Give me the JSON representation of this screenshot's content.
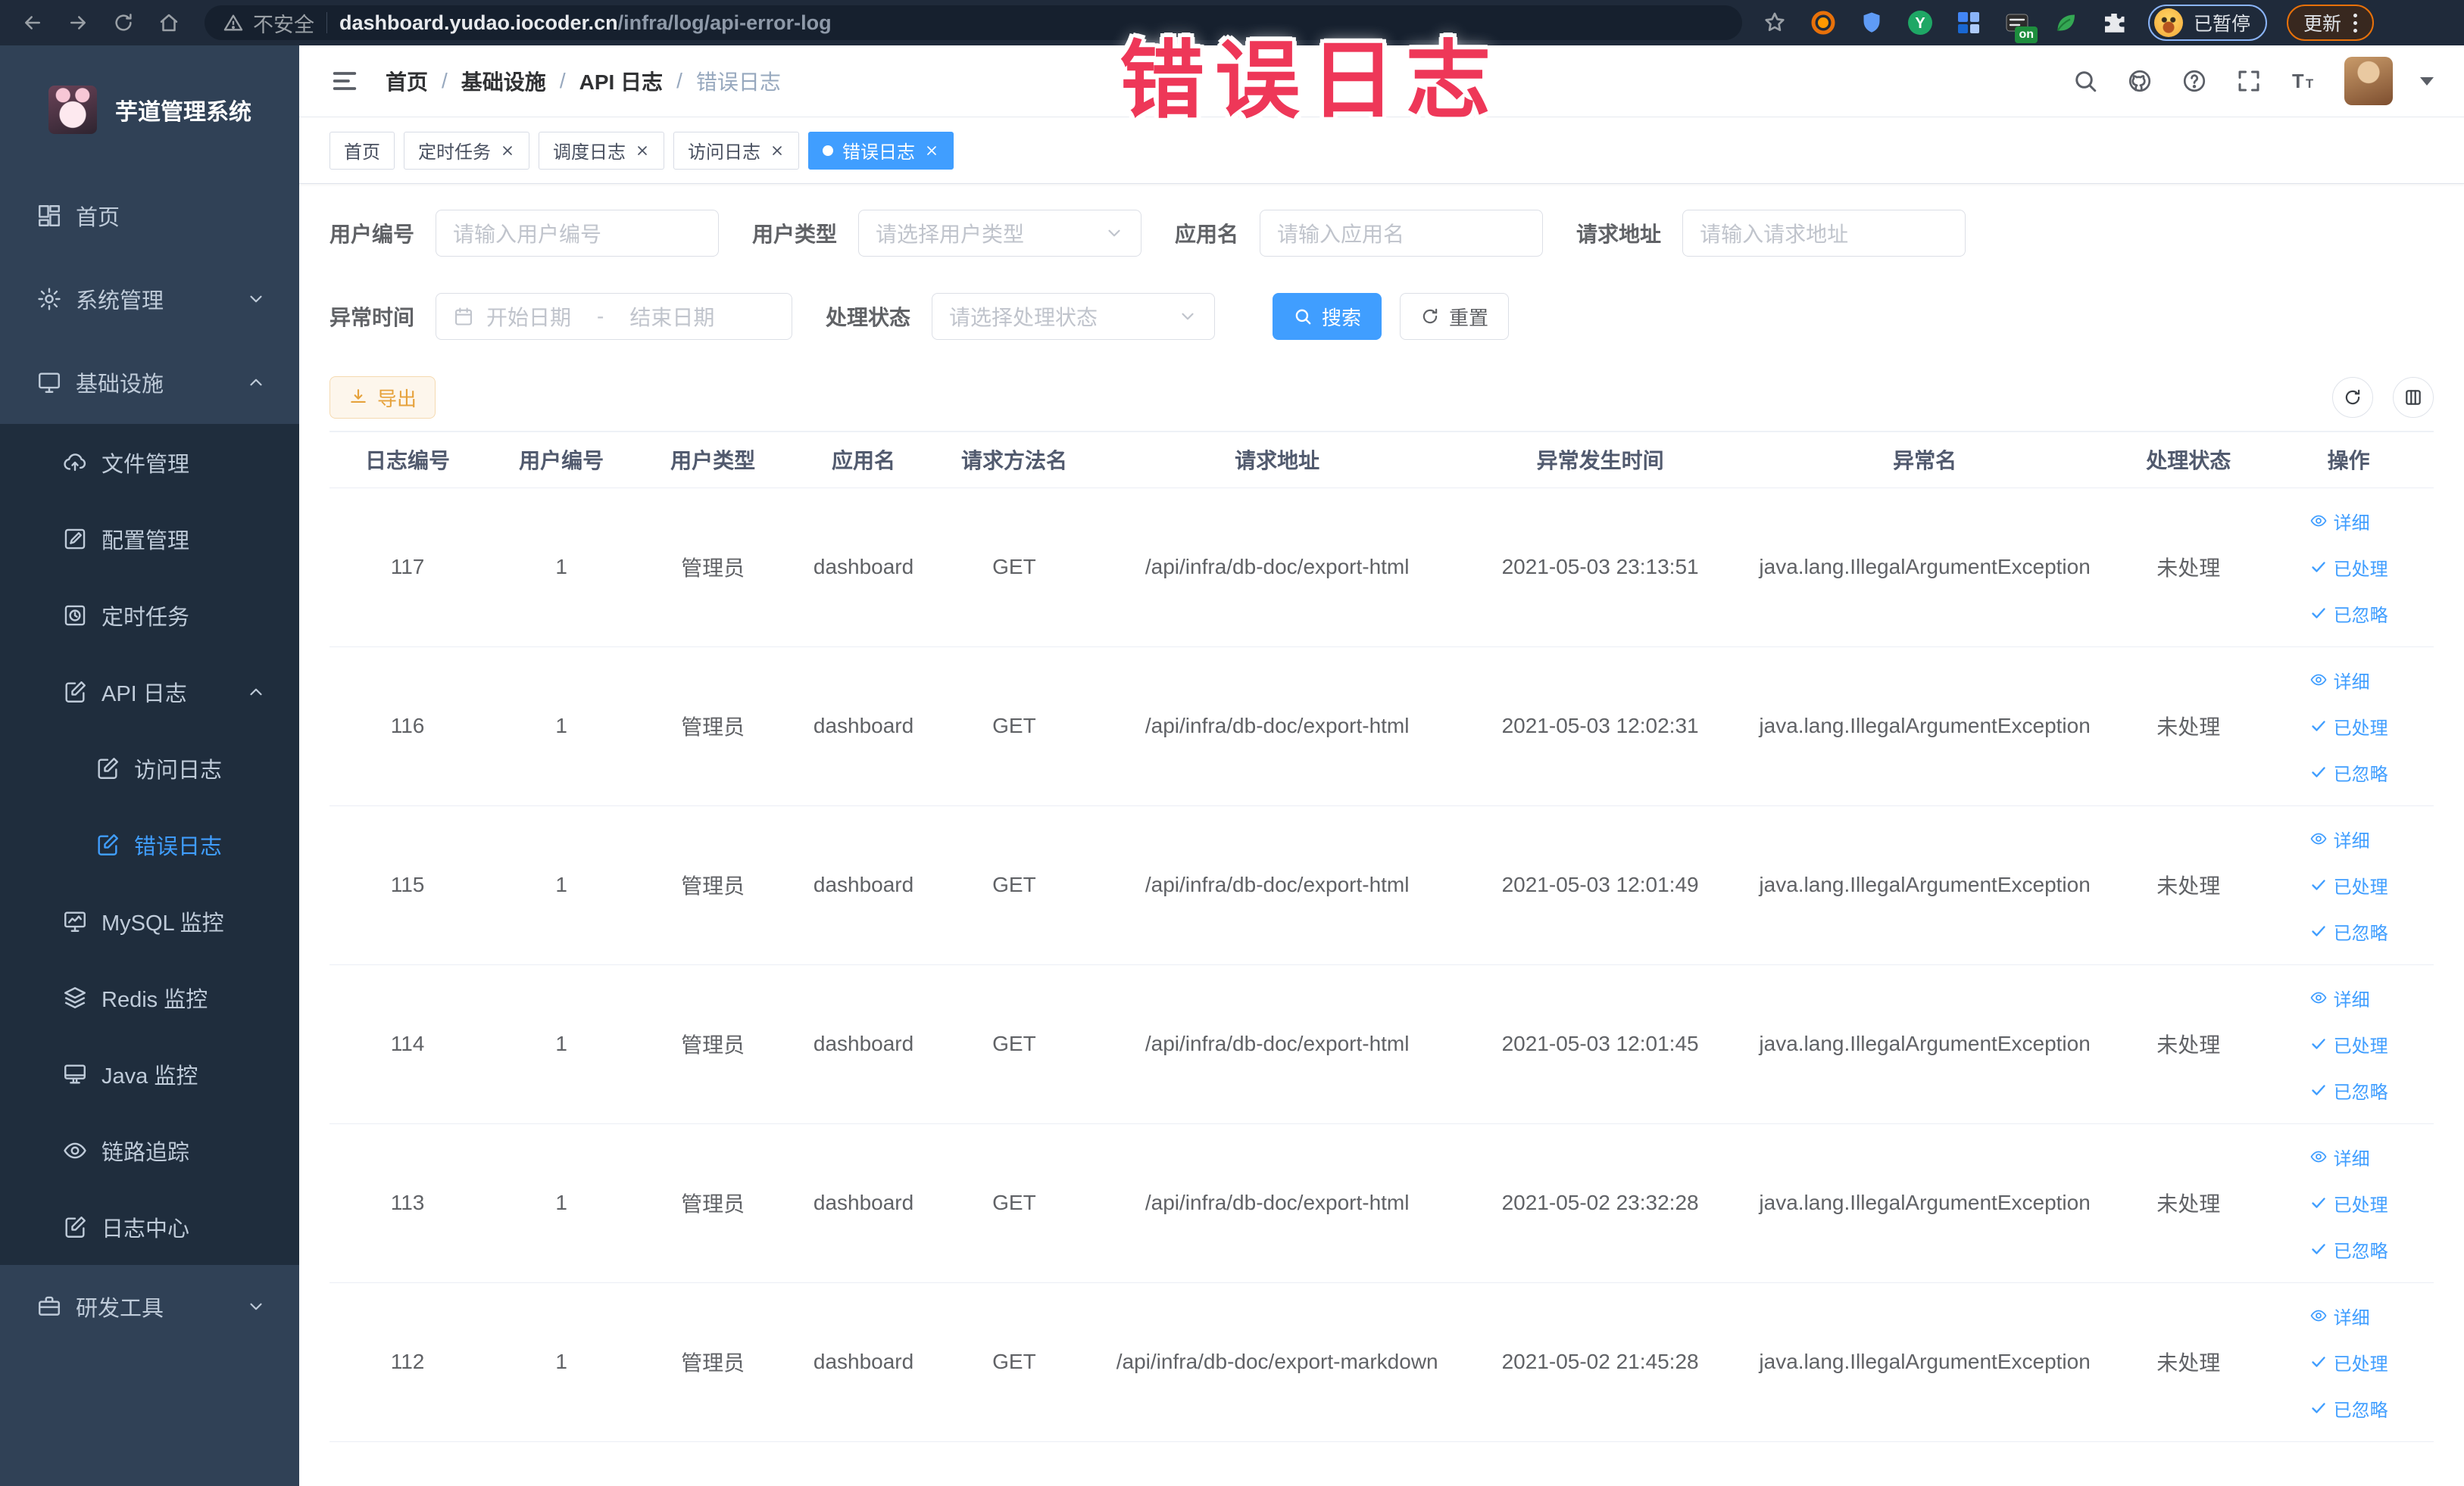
{
  "colors": {
    "primary": "#409eff",
    "annotation": "#ee3758",
    "export_text": "#e6a23c",
    "export_bg": "#fdf6ec",
    "export_border": "#f5dab1",
    "sidebar_bg": "#304156",
    "submenu_bg": "#1f2d3d",
    "sidebar_text": "#bfcbd9",
    "chrome_bg": "#1f2a3a"
  },
  "browser": {
    "security_label": "不安全",
    "url_domain": "dashboard.yudao.iocoder.cn",
    "url_path": "/infra/log/api-error-log",
    "extension_badge": "on",
    "profile_pill_label": "已暂停",
    "update_button_label": "更新"
  },
  "annotation": {
    "text": "错误日志"
  },
  "sidebar": {
    "title": "芋道管理系统",
    "items": [
      {
        "label": "首页"
      },
      {
        "label": "系统管理"
      },
      {
        "label": "基础设施"
      },
      {
        "label": "文件管理"
      },
      {
        "label": "配置管理"
      },
      {
        "label": "定时任务"
      },
      {
        "label": "API 日志"
      },
      {
        "label": "访问日志"
      },
      {
        "label": "错误日志"
      },
      {
        "label": "MySQL 监控"
      },
      {
        "label": "Redis 监控"
      },
      {
        "label": "Java 监控"
      },
      {
        "label": "链路追踪"
      },
      {
        "label": "日志中心"
      },
      {
        "label": "研发工具"
      }
    ]
  },
  "navbar": {
    "breadcrumb": [
      "首页",
      "基础设施",
      "API 日志",
      "错误日志"
    ],
    "separator": "/"
  },
  "tags": [
    {
      "label": "首页",
      "closable": false,
      "active": false
    },
    {
      "label": "定时任务",
      "closable": true,
      "active": false
    },
    {
      "label": "调度日志",
      "closable": true,
      "active": false
    },
    {
      "label": "访问日志",
      "closable": true,
      "active": false
    },
    {
      "label": "错误日志",
      "closable": true,
      "active": true
    }
  ],
  "filters": {
    "user_id": {
      "label": "用户编号",
      "placeholder": "请输入用户编号"
    },
    "user_type": {
      "label": "用户类型",
      "placeholder": "请选择用户类型"
    },
    "app_name": {
      "label": "应用名",
      "placeholder": "请输入应用名"
    },
    "request_url": {
      "label": "请求地址",
      "placeholder": "请输入请求地址"
    },
    "exception_time": {
      "label": "异常时间",
      "start_placeholder": "开始日期",
      "separator": "-",
      "end_placeholder": "结束日期"
    },
    "process_status": {
      "label": "处理状态",
      "placeholder": "请选择处理状态"
    },
    "search_label": "搜索",
    "reset_label": "重置"
  },
  "toolbar": {
    "export_label": "导出"
  },
  "table": {
    "columns": [
      {
        "key": "id",
        "label": "日志编号",
        "width": "7.42%"
      },
      {
        "key": "user_id",
        "label": "用户编号",
        "width": "7.2%"
      },
      {
        "key": "user_type",
        "label": "用户类型",
        "width": "7.2%"
      },
      {
        "key": "app",
        "label": "应用名",
        "width": "7.12%"
      },
      {
        "key": "method",
        "label": "请求方法名",
        "width": "7.2%"
      },
      {
        "key": "url",
        "label": "请求地址",
        "width": "17.8%"
      },
      {
        "key": "time",
        "label": "异常发生时间",
        "width": "12.9%"
      },
      {
        "key": "exception",
        "label": "异常名",
        "width": "17.95%"
      },
      {
        "key": "status",
        "label": "处理状态",
        "width": "7.12%"
      },
      {
        "key": "actions",
        "label": "操作",
        "width": "8.09%"
      }
    ],
    "rows": [
      {
        "id": "117",
        "user_id": "1",
        "user_type": "管理员",
        "app": "dashboard",
        "method": "GET",
        "url": "/api/infra/db-doc/export-html",
        "time": "2021-05-03 23:13:51",
        "exception": "java.lang.IllegalArgumentException",
        "status": "未处理"
      },
      {
        "id": "116",
        "user_id": "1",
        "user_type": "管理员",
        "app": "dashboard",
        "method": "GET",
        "url": "/api/infra/db-doc/export-html",
        "time": "2021-05-03 12:02:31",
        "exception": "java.lang.IllegalArgumentException",
        "status": "未处理"
      },
      {
        "id": "115",
        "user_id": "1",
        "user_type": "管理员",
        "app": "dashboard",
        "method": "GET",
        "url": "/api/infra/db-doc/export-html",
        "time": "2021-05-03 12:01:49",
        "exception": "java.lang.IllegalArgumentException",
        "status": "未处理"
      },
      {
        "id": "114",
        "user_id": "1",
        "user_type": "管理员",
        "app": "dashboard",
        "method": "GET",
        "url": "/api/infra/db-doc/export-html",
        "time": "2021-05-03 12:01:45",
        "exception": "java.lang.IllegalArgumentException",
        "status": "未处理"
      },
      {
        "id": "113",
        "user_id": "1",
        "user_type": "管理员",
        "app": "dashboard",
        "method": "GET",
        "url": "/api/infra/db-doc/export-html",
        "time": "2021-05-02 23:32:28",
        "exception": "java.lang.IllegalArgumentException",
        "status": "未处理"
      },
      {
        "id": "112",
        "user_id": "1",
        "user_type": "管理员",
        "app": "dashboard",
        "method": "GET",
        "url": "/api/infra/db-doc/export-markdown",
        "time": "2021-05-02 21:45:28",
        "exception": "java.lang.IllegalArgumentException",
        "status": "未处理"
      }
    ],
    "row_actions": [
      {
        "label": "详细",
        "icon": "eye"
      },
      {
        "label": "已处理",
        "icon": "check"
      },
      {
        "label": "已忽略",
        "icon": "check"
      }
    ]
  }
}
